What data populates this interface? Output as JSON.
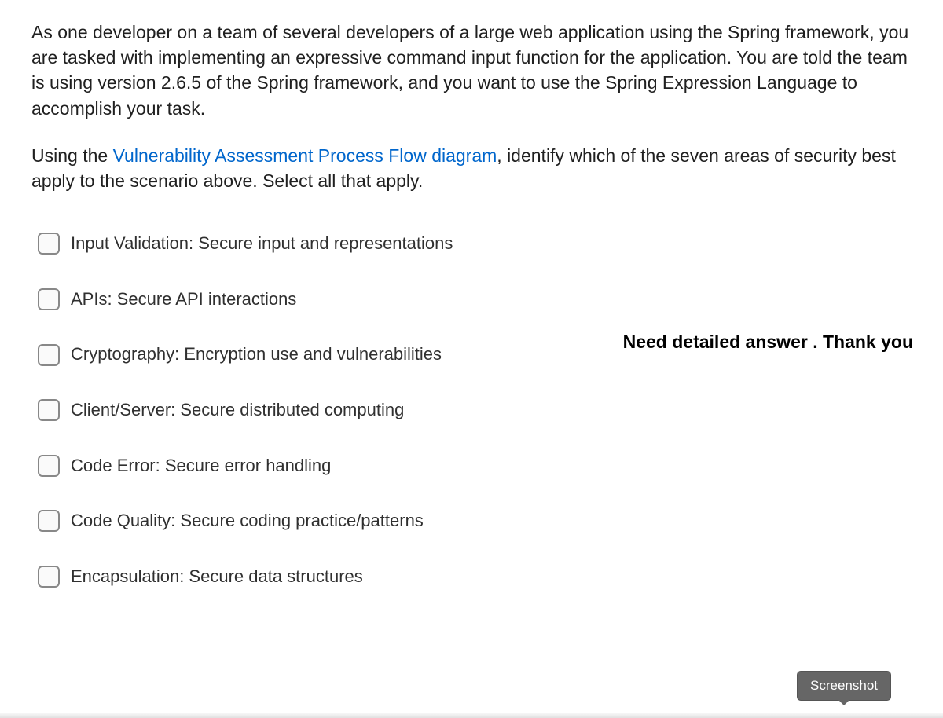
{
  "question": {
    "scenario": "As one developer on a team of several developers of a large web application using the Spring framework, you are tasked with implementing an expressive command input function for the application. You are told the team is using version 2.6.5 of the Spring framework, and you want to use the Spring Expression Language to accomplish your task.",
    "prompt_prefix": "Using the ",
    "prompt_link": "Vulnerability Assessment Process Flow diagram",
    "prompt_suffix": ", identify which of the seven areas of security best apply to the scenario above. Select all that apply."
  },
  "options": [
    {
      "label": "Input Validation: Secure input and representations"
    },
    {
      "label": "APIs: Secure API interactions"
    },
    {
      "label": "Cryptography: Encryption use and vulnerabilities"
    },
    {
      "label": "Client/Server: Secure distributed computing"
    },
    {
      "label": "Code Error: Secure error handling"
    },
    {
      "label": "Code Quality: Secure coding practice/patterns"
    },
    {
      "label": "Encapsulation: Secure data structures"
    }
  ],
  "annotation": "Need detailed answer . Thank you",
  "badge": "Screenshot"
}
